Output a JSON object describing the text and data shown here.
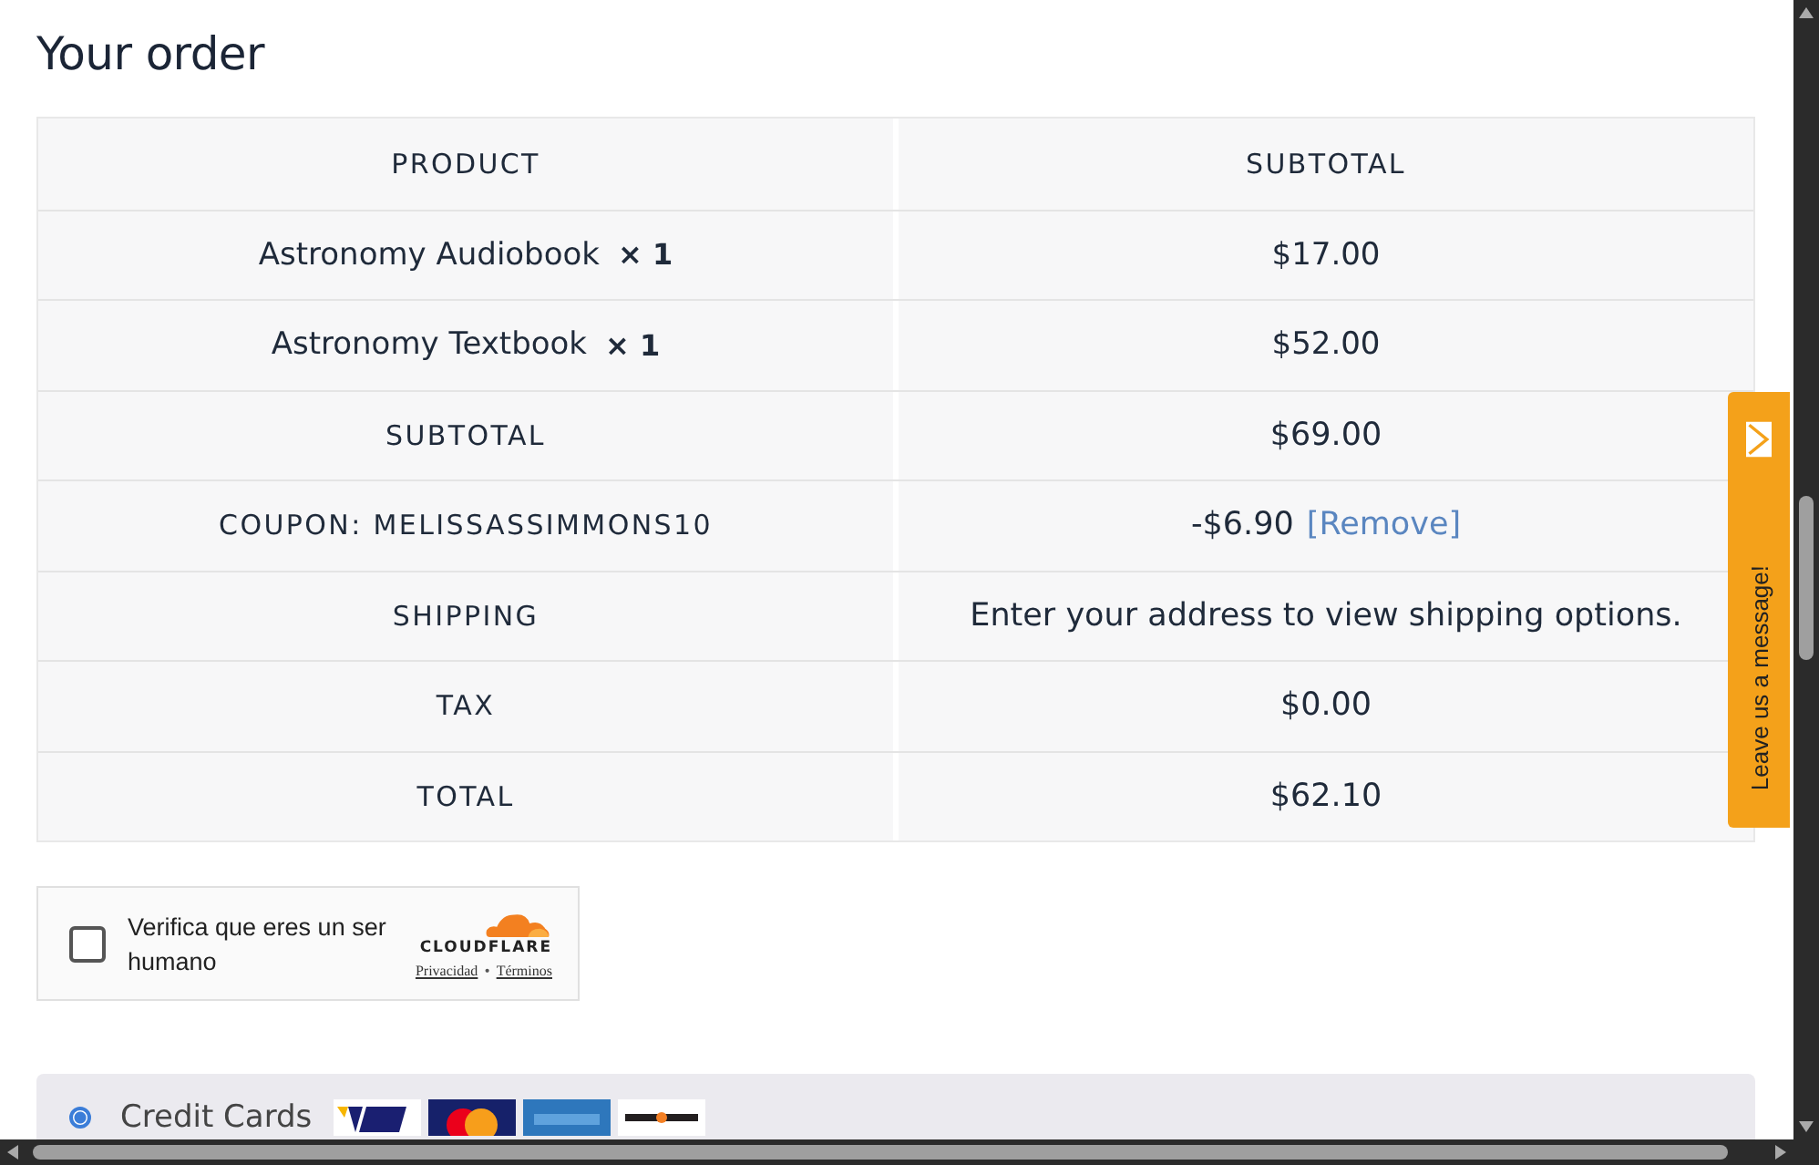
{
  "heading": "Your order",
  "table": {
    "columns": [
      "PRODUCT",
      "SUBTOTAL"
    ],
    "items": [
      {
        "name": "Astronomy Audiobook",
        "quantity": "× 1",
        "subtotal": "$17.00"
      },
      {
        "name": "Astronomy Textbook",
        "quantity": "× 1",
        "subtotal": "$52.00"
      }
    ],
    "totals": [
      {
        "label": "SUBTOTAL",
        "value": "$69.00"
      },
      {
        "label": "COUPON: MELISSASSIMMONS10",
        "value": "-$6.90",
        "link": "[Remove]"
      },
      {
        "label": "SHIPPING",
        "value": "Enter your address to view shipping options."
      },
      {
        "label": "TAX",
        "value": "$0.00"
      },
      {
        "label": "TOTAL",
        "value": "$62.10"
      }
    ]
  },
  "captcha": {
    "label": "Verifica que eres un ser humano",
    "checked": false,
    "brand": "CLOUDFLARE",
    "links": [
      "Privacidad",
      "Términos"
    ],
    "separator": "•"
  },
  "payment": {
    "methods": [
      {
        "label": "Credit Cards",
        "selected": true
      }
    ]
  },
  "chat_tab": {
    "label": "Leave us a message!"
  }
}
